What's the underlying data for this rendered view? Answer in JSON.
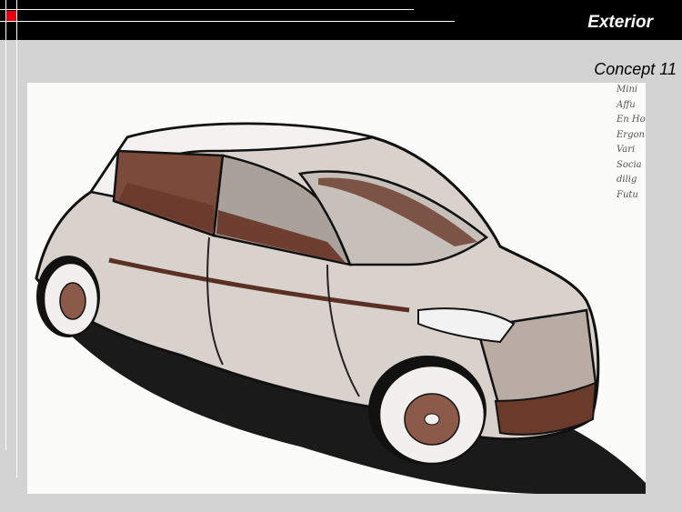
{
  "header": {
    "title": "Exterior"
  },
  "slide": {
    "subtitle": "Concept 11"
  },
  "sketch": {
    "notes": [
      "Mini",
      "Affu",
      "En Ho",
      "Ergon",
      "Vari",
      "Socia",
      "dilig",
      "Futu"
    ]
  },
  "colors": {
    "header_bg": "#000000",
    "accent": "#e3000f",
    "background": "#d3d3d3"
  }
}
